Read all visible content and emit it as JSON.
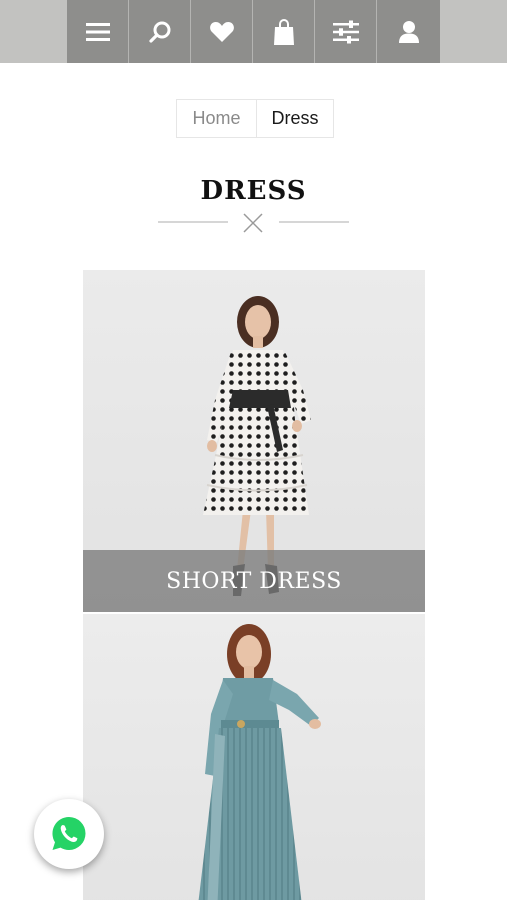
{
  "header": {
    "icons": [
      "menu-icon",
      "search-icon",
      "heart-icon",
      "shopping-bag-icon",
      "filter-icon",
      "user-icon"
    ],
    "bar_color": "#8e8e8c",
    "background_color": "#c2c2c0"
  },
  "breadcrumb": {
    "home": "Home",
    "current": "Dress"
  },
  "page": {
    "title": "DRESS"
  },
  "products": [
    {
      "label": "SHORT DRESS"
    },
    {
      "label": ""
    }
  ],
  "floating": {
    "icon": "whatsapp-icon",
    "color": "#25d366"
  }
}
